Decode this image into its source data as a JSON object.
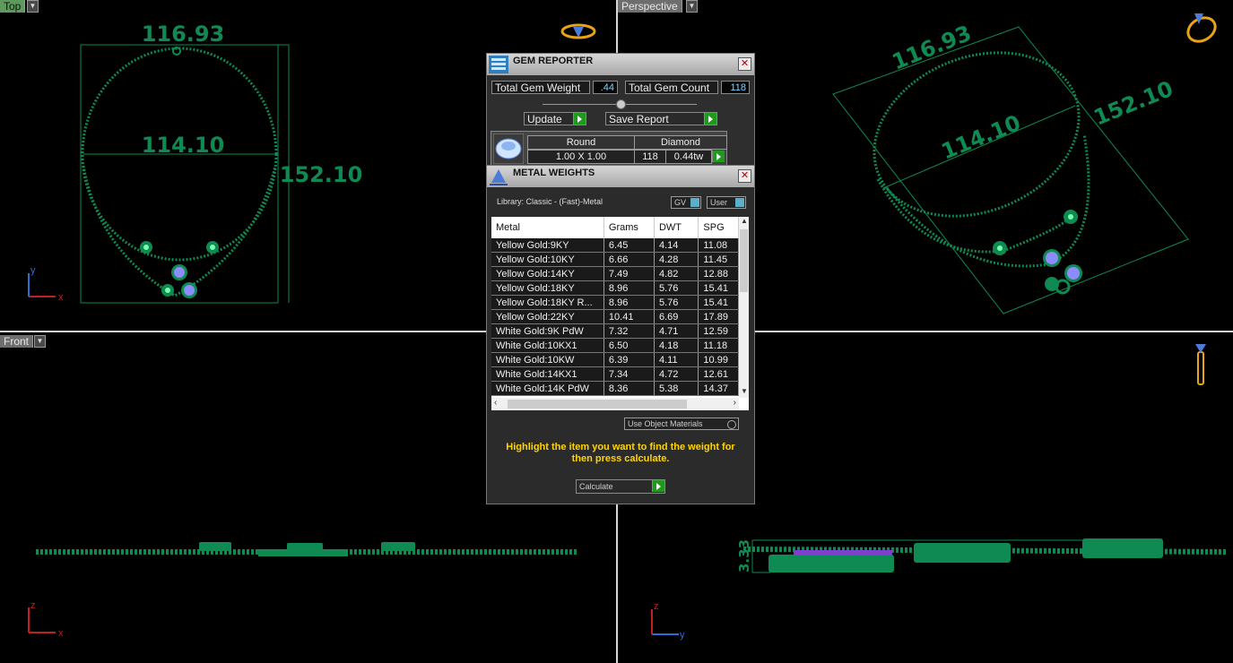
{
  "viewports": {
    "top": {
      "label": "Top"
    },
    "perspective": {
      "label": "Perspective"
    },
    "front": {
      "label": "Front"
    }
  },
  "dimensions": {
    "width_top": "116.93",
    "width_inner": "114.10",
    "height": "152.10",
    "thickness": "3.33"
  },
  "axes": {
    "x": "x",
    "y": "y",
    "z": "z"
  },
  "gem_reporter": {
    "title": "GEM REPORTER",
    "total_weight_label": "Total Gem Weight",
    "total_weight_value": ".44",
    "total_count_label": "Total Gem Count",
    "total_count_value": "118",
    "update_label": "Update",
    "save_report_label": "Save Report",
    "gem": {
      "shape": "Round",
      "type": "Diamond",
      "size": "1.00 X 1.00",
      "count": "118",
      "weight": "0.44tw"
    }
  },
  "metal_weights": {
    "title": "METAL WEIGHTS",
    "library_label": "Library: Classic - (Fast)-Metal",
    "gv_label": "GV",
    "user_label": "User",
    "columns": [
      "Metal",
      "Grams",
      "DWT",
      "SPG"
    ],
    "rows": [
      [
        "Yellow Gold:9KY",
        "6.45",
        "4.14",
        "11.08"
      ],
      [
        "Yellow Gold:10KY",
        "6.66",
        "4.28",
        "11.45"
      ],
      [
        "Yellow Gold:14KY",
        "7.49",
        "4.82",
        "12.88"
      ],
      [
        "Yellow Gold:18KY",
        "8.96",
        "5.76",
        "15.41"
      ],
      [
        "Yellow Gold:18KY R...",
        "8.96",
        "5.76",
        "15.41"
      ],
      [
        "Yellow Gold:22KY",
        "10.41",
        "6.69",
        "17.89"
      ],
      [
        "White Gold:9K PdW",
        "7.32",
        "4.71",
        "12.59"
      ],
      [
        "White Gold:10KX1",
        "6.50",
        "4.18",
        "11.18"
      ],
      [
        "White Gold:10KW",
        "6.39",
        "4.11",
        "10.99"
      ],
      [
        "White Gold:14KX1",
        "7.34",
        "4.72",
        "12.61"
      ],
      [
        "White Gold:14K PdW",
        "8.36",
        "5.38",
        "14.37"
      ]
    ],
    "use_object_materials_label": "Use Object Materials",
    "hint": "Highlight the item you want to find the weight for then press calculate.",
    "calculate_label": "Calculate"
  },
  "colors": {
    "model": "#0e8a52",
    "hint": "#ffd400",
    "gem": "#7f7fff"
  }
}
